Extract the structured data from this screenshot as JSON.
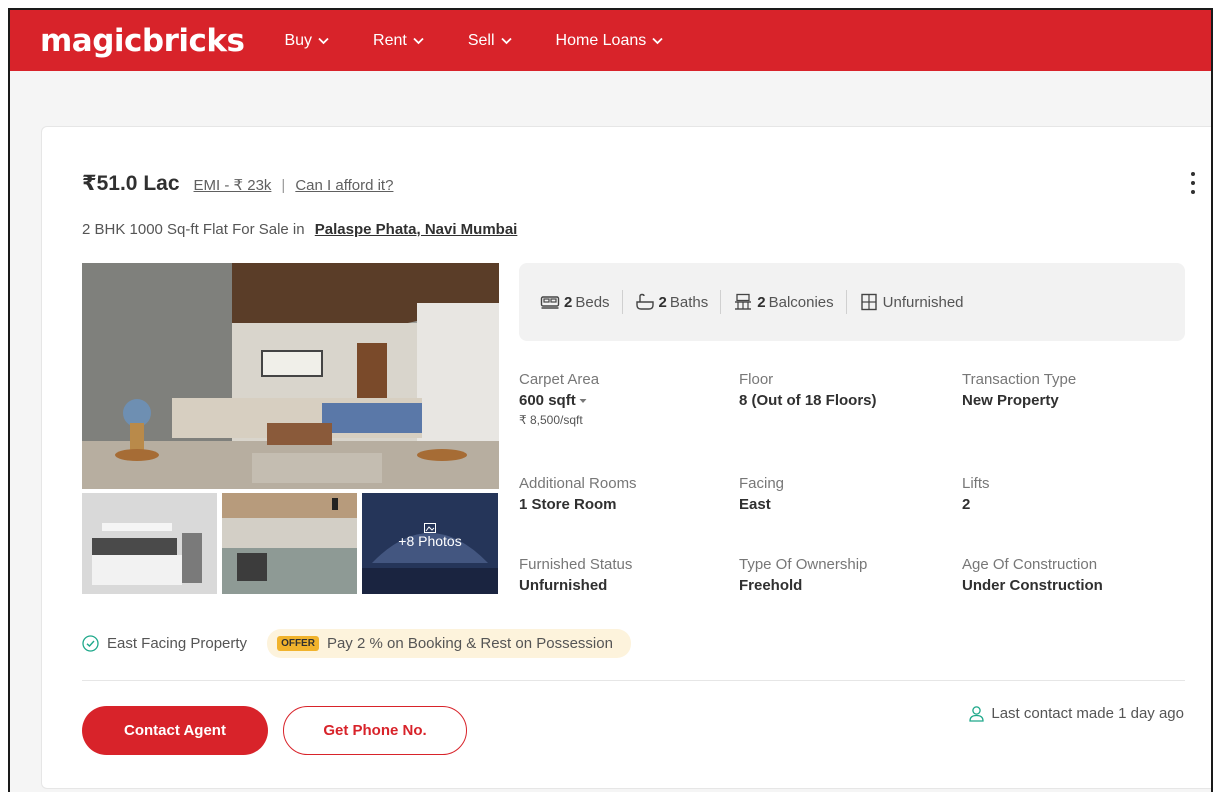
{
  "header": {
    "logo": "magicbricks",
    "nav": [
      {
        "label": "Buy"
      },
      {
        "label": "Rent"
      },
      {
        "label": "Sell"
      },
      {
        "label": "Home Loans"
      }
    ]
  },
  "listing": {
    "price": "₹51.0 Lac",
    "emi": "EMI - ₹ 23k",
    "separator": "|",
    "afford": "Can I afford it?",
    "subtitle": "2 BHK 1000 Sq-ft Flat For Sale in",
    "location": "Palaspe Phata, Navi Mumbai",
    "more_photos": "+8 Photos",
    "amenities": [
      {
        "icon": "bed-icon",
        "count": "2",
        "label": "Beds"
      },
      {
        "icon": "bath-icon",
        "count": "2",
        "label": "Baths"
      },
      {
        "icon": "balcony-icon",
        "count": "2",
        "label": "Balconies"
      },
      {
        "icon": "furnish-icon",
        "count": "",
        "label": "Unfurnished"
      }
    ],
    "details": [
      {
        "label": "Carpet Area",
        "value": "600 sqft",
        "sub": "₹ 8,500/sqft"
      },
      {
        "label": "Floor",
        "value": "8 (Out of 18 Floors)"
      },
      {
        "label": "Transaction Type",
        "value": "New Property"
      },
      {
        "label": "Additional Rooms",
        "value": "1 Store Room"
      },
      {
        "label": "Facing",
        "value": "East"
      },
      {
        "label": "Lifts",
        "value": "2"
      },
      {
        "label": "Furnished Status",
        "value": "Unfurnished"
      },
      {
        "label": "Type Of Ownership",
        "value": "Freehold"
      },
      {
        "label": "Age Of Construction",
        "value": "Under Construction"
      }
    ],
    "tag": "East Facing Property",
    "offer_badge": "OFFER",
    "offer_text": "Pay 2 % on Booking & Rest on Possession",
    "contact_btn": "Contact Agent",
    "phone_btn": "Get Phone No.",
    "last_contact": "Last contact made 1 day ago"
  },
  "colors": {
    "brand": "#d8232a",
    "offer_bg": "#fdf3dc",
    "offer_badge": "#f1b32c",
    "check": "#1ea88a"
  }
}
